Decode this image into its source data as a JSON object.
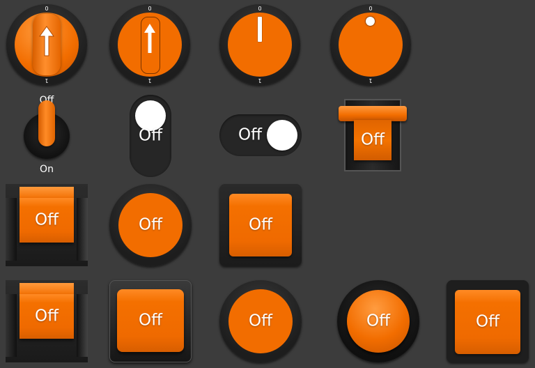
{
  "knobs": {
    "tick_top": "0",
    "tick_bottom": "1"
  },
  "toggle": {
    "top_label": "Off",
    "bottom_label": "On"
  },
  "switch_labels": {
    "vertical_slide": "Off",
    "horizontal_slide": "Off",
    "rocker_top": "Off"
  },
  "buttons_row3": {
    "rocker": "Off",
    "round": "Off",
    "square": "Off"
  },
  "buttons_row4": {
    "rocker": "Off",
    "square_raised": "Off",
    "round_flat": "Off",
    "round_glossy": "Off",
    "square_glossy": "Off"
  },
  "colors": {
    "background": "#3c3c3c",
    "accent": "#f26d00",
    "frame": "#1e1e1e",
    "indicator": "#ffffff"
  }
}
